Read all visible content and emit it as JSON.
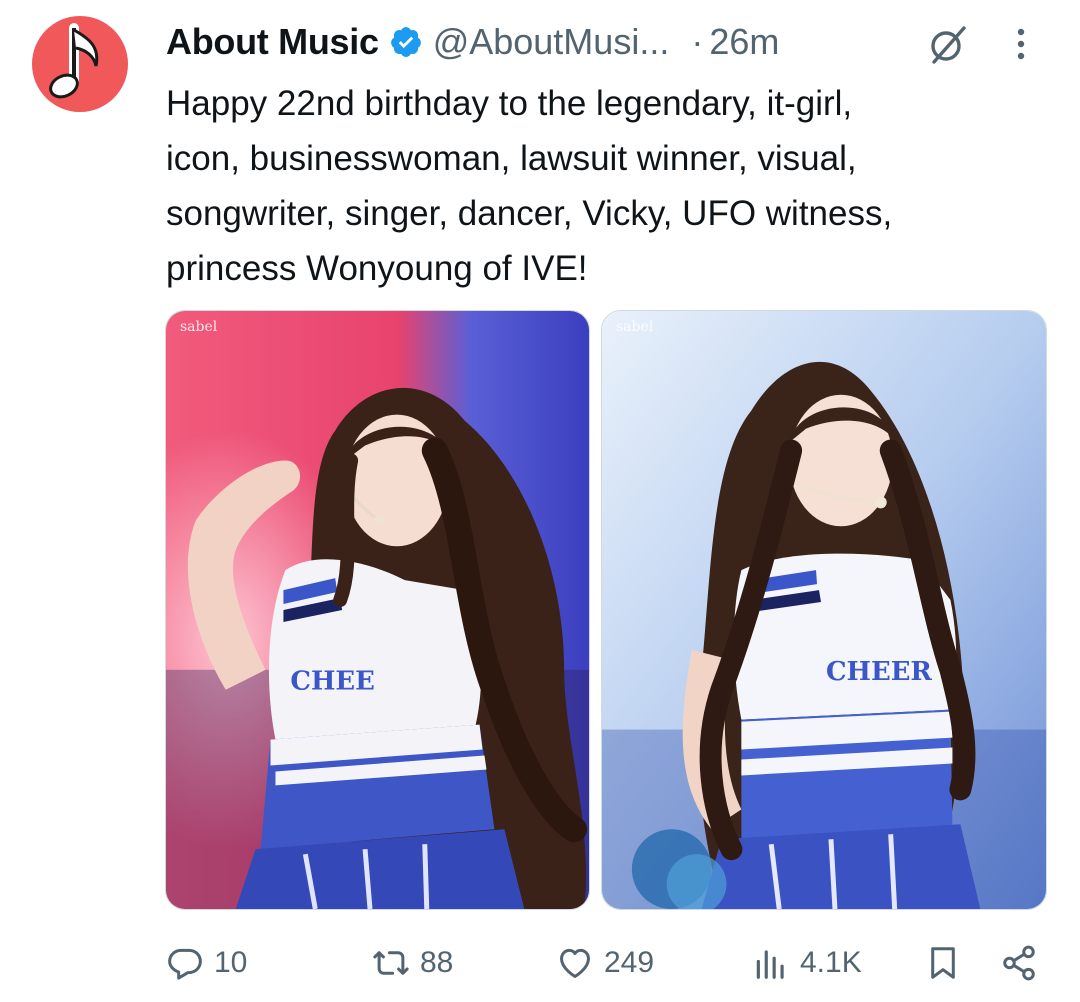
{
  "tweet": {
    "author_name": "About Music",
    "handle": "@AboutMusi...",
    "separator": "·",
    "time": "26m",
    "text": "Happy 22nd birthday to the legendary, it-girl,\nicon, businesswoman, lawsuit winner, visual,\nsongwriter, singer, dancer, Vicky, UFO witness,\nprincess Wonyoung of IVE!",
    "images": [
      {
        "watermark": "sabel"
      },
      {
        "watermark": "sabel"
      }
    ]
  },
  "actions": {
    "replies": "10",
    "reposts": "88",
    "likes": "249",
    "views": "4.1K"
  },
  "colors": {
    "avatar_bg": "#f0585a",
    "verified": "#1d9bf0",
    "secondary_text": "#536471"
  },
  "icons": {
    "avatar": "music-note-icon",
    "verified": "verified-badge-icon",
    "grok": "grok-icon",
    "more": "more-icon",
    "reply": "reply-icon",
    "repost": "repost-icon",
    "like": "like-icon",
    "views": "views-icon",
    "bookmark": "bookmark-icon",
    "share": "share-icon"
  }
}
